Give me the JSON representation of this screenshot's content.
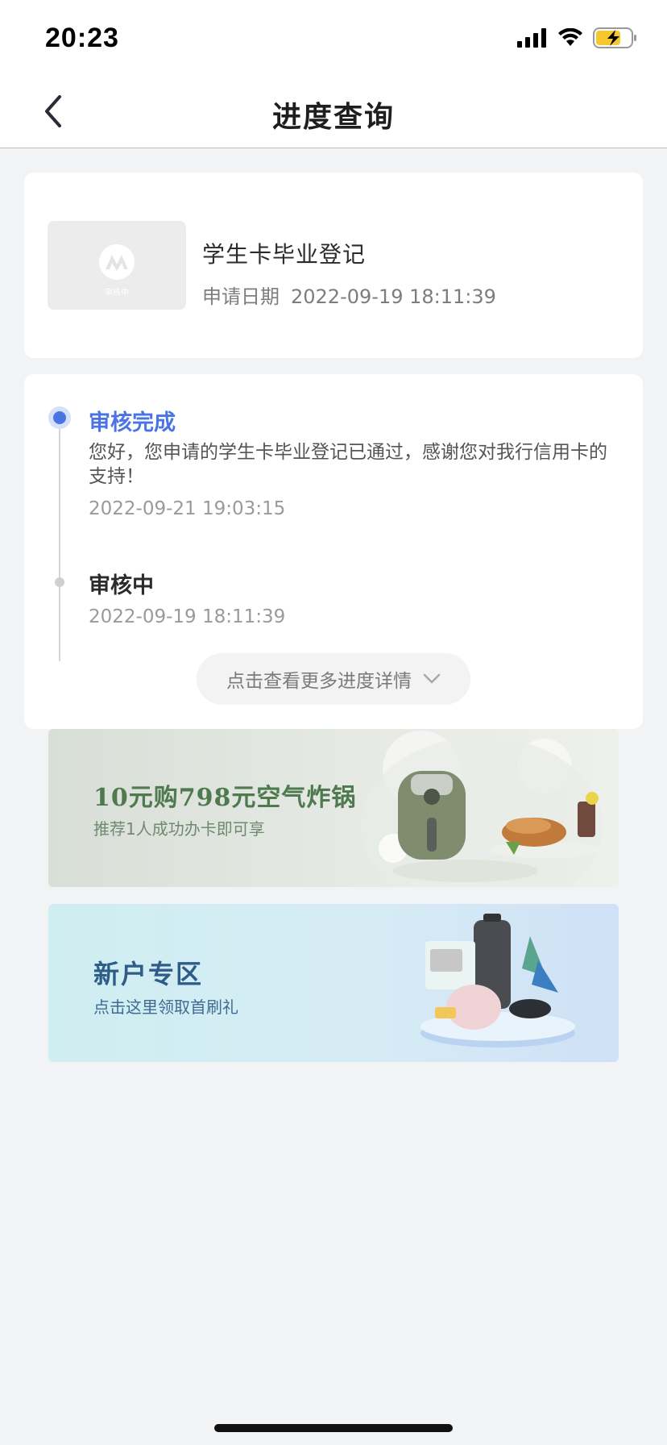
{
  "status_bar": {
    "time": "20:23",
    "icons": [
      "signal-icon",
      "wifi-icon",
      "battery-charging-icon"
    ],
    "battery_color": "#f5c830"
  },
  "nav": {
    "title": "进度查询",
    "back_icon": "chevron-left-icon"
  },
  "application": {
    "thumb_text": "审核中",
    "title": "学生卡毕业登记",
    "date_label": "申请日期",
    "date_value": "2022-09-19 18:11:39"
  },
  "progress": {
    "accent_color": "#4a74e6",
    "steps": [
      {
        "title": "审核完成",
        "description": "您好，您申请的学生卡毕业登记已通过，感谢您对我行信用卡的支持！",
        "time": "2022-09-21 19:03:15"
      },
      {
        "title": "审核中",
        "time": "2022-09-19 18:11:39"
      }
    ],
    "more_label": "点击查看更多进度详情"
  },
  "banners": [
    {
      "title": "10元购798元空气炸锅",
      "subtitle": "推荐1人成功办卡即可享"
    },
    {
      "title": "新户专区",
      "subtitle": "点击这里领取首刷礼"
    }
  ]
}
